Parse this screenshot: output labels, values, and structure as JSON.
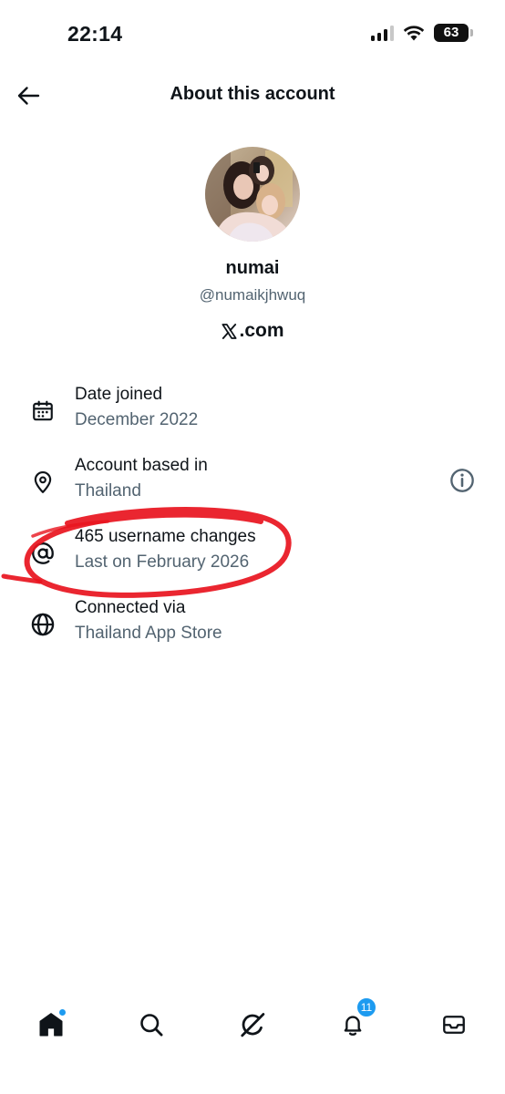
{
  "status": {
    "time": "22:14",
    "battery": "63"
  },
  "header": {
    "title": "About this account"
  },
  "profile": {
    "display_name": "numai",
    "handle": "@numaikjhwuq",
    "site": ".com",
    "site_icon": "x-logo-icon",
    "avatar": "profile-photo"
  },
  "rows": [
    {
      "icon": "calendar-icon",
      "title": "Date joined",
      "value": "December 2022"
    },
    {
      "icon": "location-pin-icon",
      "title": "Account based in",
      "value": "Thailand",
      "action_icon": "info-icon"
    },
    {
      "icon": "at-sign-icon",
      "title": "465 username changes",
      "value": "Last on February 2026"
    },
    {
      "icon": "globe-icon",
      "title": "Connected via",
      "value": "Thailand App Store"
    }
  ],
  "annotation": {
    "color": "#e8141e",
    "shape": "hand-drawn ellipse around username changes row"
  },
  "nav": {
    "items": [
      "home-icon",
      "search-icon",
      "grok-icon",
      "notifications-icon",
      "messages-icon"
    ],
    "notification_count": "11",
    "home_has_dot": true,
    "accent": "#1d9bf0"
  },
  "colors": {
    "text_primary": "#0f1419",
    "text_secondary": "#536471",
    "accent": "#1d9bf0"
  }
}
